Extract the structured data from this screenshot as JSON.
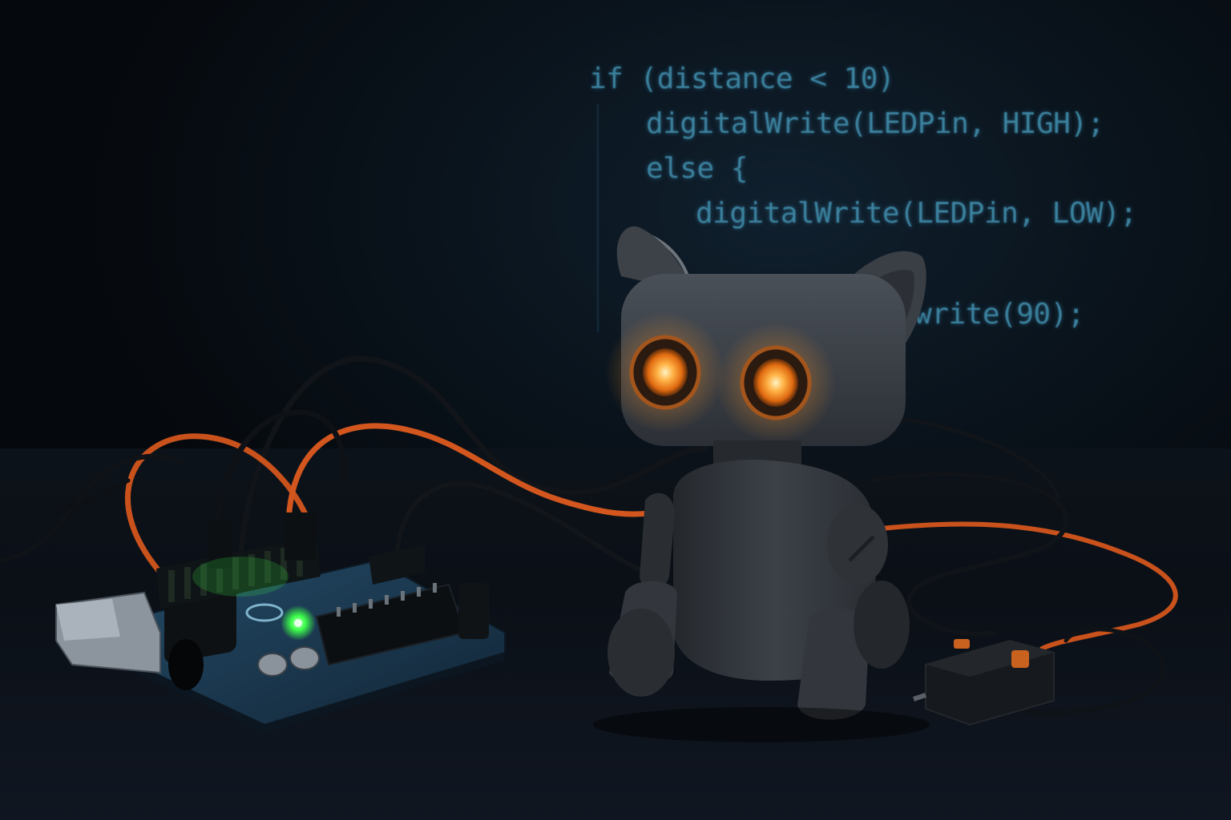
{
  "code": {
    "lines": [
      "if (distance < 10)",
      "digitalWrite(LEDPin, HIGH);",
      "else {",
      "digitalWrite(LEDPin, LOW);",
      ".write(90);"
    ]
  },
  "colors": {
    "background": "#070b10",
    "code_text": "#3f8aa8",
    "robot_body": "#3a3f46",
    "robot_eye_glow": "#ff9a2e",
    "wire_orange": "#d2561e",
    "wire_black": "#111418",
    "arduino_board": "#1d3b52",
    "status_led": "#3cff4a"
  },
  "scene": {
    "subjects": [
      "robot-cat",
      "arduino-board",
      "jumper-wires",
      "servo-module"
    ]
  }
}
